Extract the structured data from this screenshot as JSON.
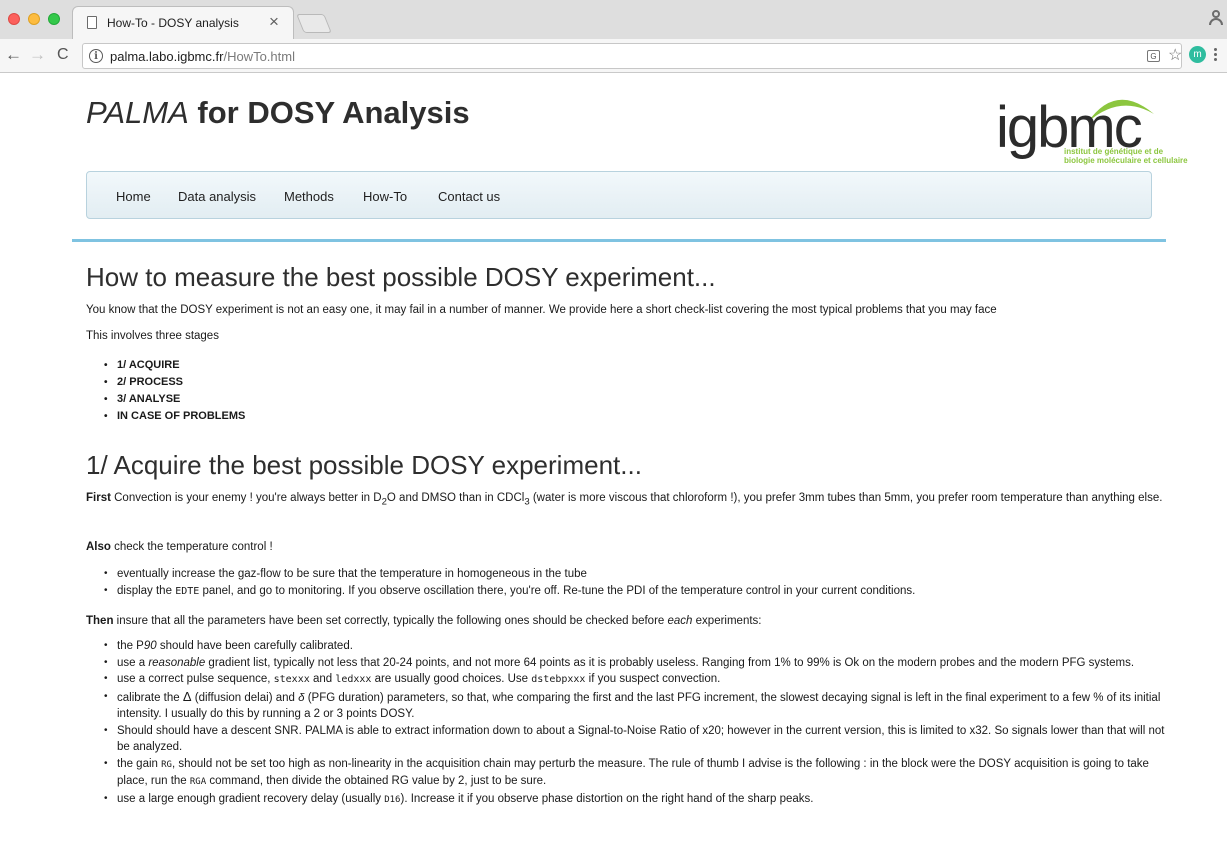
{
  "browser": {
    "tab_title": "How-To - DOSY analysis",
    "tab_close": "×",
    "url_host": "palma.labo.igbmc.fr",
    "url_path": "/HowTo.html",
    "extension_label": "m"
  },
  "site": {
    "title_italic": "PALMA",
    "title_rest": " for DOSY Analysis",
    "logo_word": "igbmc",
    "logo_sub_line1": "institut de génétique et de",
    "logo_sub_line2": "biologie moléculaire et cellulaire",
    "logo_colors": {
      "text": "#2c2c2c",
      "accent": "#8cc63f"
    }
  },
  "nav": {
    "items": [
      "Home",
      "Data analysis",
      "Methods",
      "How-To",
      "Contact us"
    ]
  },
  "section1": {
    "heading": "How to measure the best possible DOSY experiment...",
    "intro": "You know that the DOSY experiment is not an easy one, it may fail in a number of manner. We provide here a short check-list covering the most typical problems that you may face",
    "stages_intro": "This involves three stages",
    "stages": [
      "1/ ACQUIRE",
      "2/ PROCESS",
      "3/ ANALYSE",
      "IN CASE OF PROBLEMS"
    ]
  },
  "section2": {
    "heading": "1/ Acquire the best possible DOSY experiment...",
    "first_label": "First",
    "first_text_a": " Convection is your enemy ! you're always better in D",
    "first_sub1": "2",
    "first_text_b": "O and DMSO than in CDCl",
    "first_sub2": "3",
    "first_text_c": " (water is more viscous that chloroform !), you prefer 3mm tubes than 5mm, you prefer room temperature than anything else.",
    "also_label": "Also",
    "also_text": " check the temperature control !",
    "temp_item1": "eventually increase the gaz-flow to be sure that the temperature in homogeneous in the tube",
    "temp_item2_a": "display the ",
    "temp_item2_code": "EDTE",
    "temp_item2_b": " panel, and go to monitoring. If you observe oscillation there, you're off. Re-tune the PDI of the temperature control in your current conditions.",
    "then_label": "Then",
    "then_text_a": " insure that all the parameters have been set correctly, typically the following ones should be checked before ",
    "then_text_em": "each",
    "then_text_b": " experiments:",
    "p90_a": "the P",
    "p90_em": "90",
    "p90_b": " should have been carefully calibrated.",
    "grad_a": "use a ",
    "grad_em": "reasonable",
    "grad_b": " gradient list, typically not less that 20-24 points, and not more 64 points as it is probably useless. Ranging from 1% to 99% is Ok on the modern probes and the modern PFG systems.",
    "pulse_a": "use a correct pulse sequence, ",
    "pulse_code1": "stexxx",
    "pulse_b": " and ",
    "pulse_code2": "ledxxx",
    "pulse_c": " are usually good choices. Use ",
    "pulse_code3": "dstebpxxx",
    "pulse_d": " if you suspect convection.",
    "calib_a": "calibrate the ",
    "calib_delta": "Δ",
    "calib_b": " (diffusion delai) and ",
    "calib_small_delta": "δ",
    "calib_c": " (PFG duration) parameters, so that, whe comparing the first and the last PFG increment, the slowest decaying signal is left in the final experiment to a few % of its initial intensity. I usually do this by running a 2 or 3 points DOSY.",
    "snr": "Should should have a descent SNR. PALMA is able to extract information down to about a Signal-to-Noise Ratio of x20; however in the current version, this is limited to x32. So signals lower than that will not be analyzed.",
    "gain_a": "the gain ",
    "gain_code1": "RG",
    "gain_b": ", should not be set too high as non-linearity in the acquisition chain may perturb the measure. The rule of thumb I advise is the following : in the block were the DOSY acquisition is going to take place, run the ",
    "gain_code2": "RGA",
    "gain_c": " command, then divide the obtained RG value by 2, just to be sure.",
    "delay_a": "use a large enough gradient recovery delay (usually ",
    "delay_code": "D16",
    "delay_b": "). Increase it if you observe phase distortion on the right hand of the sharp peaks."
  }
}
